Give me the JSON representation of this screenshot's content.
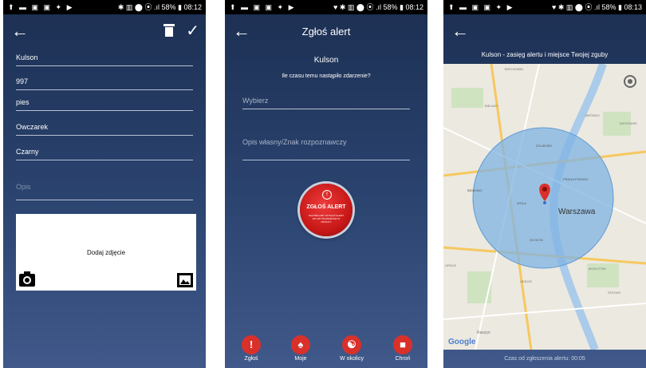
{
  "status_bar": {
    "left_icons": "⬆ ▬ ▣ ▣ ✦ ▶",
    "screens": [
      {
        "right": "✱ ▥ ⬤ ⦿ .ıl 58% ▮ 08:12"
      },
      {
        "right": "♥ ✱ ▥ ⬤ ⦿ .ıl 58% ▮ 08:12"
      },
      {
        "right": "♥ ✱ ▥ ⬤ ⦿ .ıl 58% ▮ 08:13"
      }
    ]
  },
  "screen1": {
    "fields": [
      "Kulson",
      "997",
      "pies",
      "Owczarek",
      "Czarny"
    ],
    "description_placeholder": "Opis",
    "photo_label": "Dodaj zdjęcie",
    "icons": [
      "back-arrow-icon",
      "trash-icon",
      "checkmark-icon",
      "camera-icon",
      "gallery-icon"
    ]
  },
  "screen2": {
    "title": "Zgłoś alert",
    "pet_name": "Kulson",
    "question": "Ile czasu temu nastąpiło zdarzenie?",
    "select_placeholder": "Wybierz",
    "description_placeholder": "Opis własny/Znak rozpoznawczy",
    "alert_button": {
      "label": "ZGŁOŚ ALERT",
      "small_text": "NACIŚNIJ ABY WYSŁAĆ ALERT DO UŻYTKOWNIKÓW W OKOLICY"
    },
    "nav": [
      {
        "label": "Zgłoś",
        "icon": "alert-icon"
      },
      {
        "label": "Moje",
        "icon": "pets-icon"
      },
      {
        "label": "W okolicy",
        "icon": "globe-icon"
      },
      {
        "label": "Chroń",
        "icon": "shield-icon"
      }
    ],
    "colors": {
      "accent": "#d9312a",
      "background": "#2b4470"
    }
  },
  "screen3": {
    "header": "Kulson - zasięg alertu i miejsce Twojej zguby",
    "city_label": "Warszawa",
    "google_label": "Google",
    "footer": "Czas od zgłoszenia alertu: 00:05",
    "map_labels": [
      "TARCHOMIN",
      "BIELANY",
      "BRÓDNO",
      "TARGÓWEK",
      "ŻOLIBORZ",
      "PRAGA PÓŁNOC",
      "BEMOWO",
      "WOLA",
      "OCHOTA",
      "MOKOTÓW",
      "URSUS",
      "OKĘCIE",
      "Raszyn",
      "STEGNY"
    ],
    "road_badges": [
      "579",
      "61",
      "580",
      "92",
      "637",
      "719",
      "7",
      "631",
      "721"
    ],
    "colors": {
      "radius_fill": "#7fb3e3",
      "pin": "#d9312a"
    }
  }
}
